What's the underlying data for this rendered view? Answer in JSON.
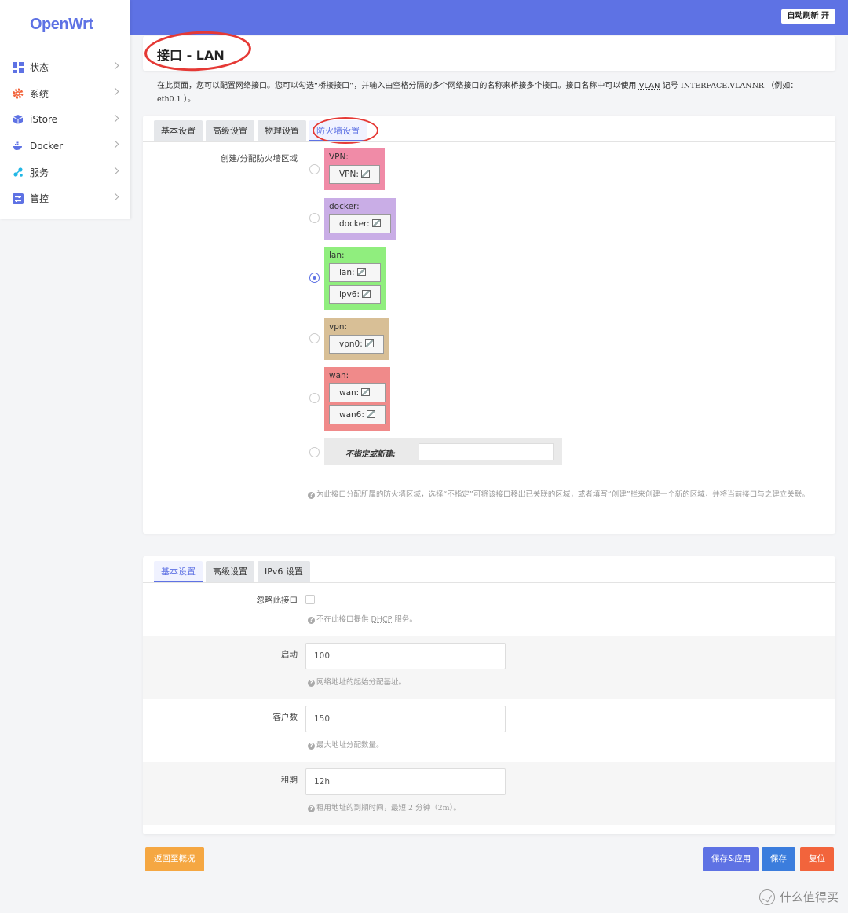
{
  "app": {
    "logo": "OpenWrt",
    "auto_refresh": "自动刷新 开"
  },
  "sidebar": {
    "items": [
      {
        "label": "状态",
        "icon": "dashboard-icon",
        "color": "#5e72e4"
      },
      {
        "label": "系统",
        "icon": "gear-icon",
        "color": "#f2643c"
      },
      {
        "label": "iStore",
        "icon": "cube-icon",
        "color": "#5e72e4"
      },
      {
        "label": "Docker",
        "icon": "docker-icon",
        "color": "#5e72e4"
      },
      {
        "label": "服务",
        "icon": "share-icon",
        "color": "#22b7e5"
      },
      {
        "label": "管控",
        "icon": "sliders-icon",
        "color": "#5e72e4"
      }
    ]
  },
  "page": {
    "title": "接口 - LAN",
    "description_1": "在此页面，您可以配置网络接口。您可以勾选“桥接接口”，并输入由空格分隔的多个网络接口的名称来桥接多个接口。接口名称中可以使用",
    "description_vlan": "VLAN",
    "description_2": "记号",
    "description_mono": "INTERFACE.VLANNR",
    "description_3": "（例如：",
    "description_example": "eth0.1",
    "description_4": "）。"
  },
  "interface_card": {
    "tabs": [
      {
        "label": "基本设置",
        "active": false
      },
      {
        "label": "高级设置",
        "active": false
      },
      {
        "label": "物理设置",
        "active": false
      },
      {
        "label": "防火墙设置",
        "active": true
      }
    ],
    "firewall_label": "创建/分配防火墙区域",
    "zones": [
      {
        "name": "VPN:",
        "color": "#f08ba7",
        "interfaces": [
          "VPN:"
        ]
      },
      {
        "name": "docker:",
        "color": "#c9ade6",
        "interfaces": [
          "docker:"
        ]
      },
      {
        "name": "lan:",
        "color": "#90ee7e",
        "interfaces": [
          "lan:",
          "ipv6:"
        ],
        "selected": true
      },
      {
        "name": "vpn:",
        "color": "#d8bf96",
        "interfaces": [
          "vpn0:"
        ]
      },
      {
        "name": "wan:",
        "color": "#f08a8a",
        "interfaces": [
          "wan:",
          "wan6:"
        ]
      }
    ],
    "new_zone_label": "不指定或新建:",
    "new_zone_value": "",
    "help": "为此接口分配所属的防火墙区域，选择“不指定”可将该接口移出已关联的区域，或者填写“创建”栏来创建一个新的区域，并将当前接口与之建立关联。"
  },
  "dhcp_card": {
    "tabs": [
      {
        "label": "基本设置",
        "active": true
      },
      {
        "label": "高级设置",
        "active": false
      },
      {
        "label": "IPv6 设置",
        "active": false
      }
    ],
    "ignore_label": "忽略此接口",
    "ignore_help_1": "不在此接口提供",
    "ignore_help_dhcp": "DHCP",
    "ignore_help_2": "服务。",
    "start_label": "启动",
    "start_value": "100",
    "start_help": "网络地址的起始分配基址。",
    "clients_label": "客户数",
    "clients_value": "150",
    "clients_help": "最大地址分配数量。",
    "lease_label": "租期",
    "lease_value": "12h",
    "lease_help_1": "租用地址的到期时间，最短 2 分钟",
    "lease_help_mono": "（2m）",
    "lease_help_2": "。"
  },
  "actions": {
    "back": "返回至概况",
    "save_apply": "保存&应用",
    "save": "保存",
    "reset": "复位"
  },
  "watermark": "什么值得买"
}
